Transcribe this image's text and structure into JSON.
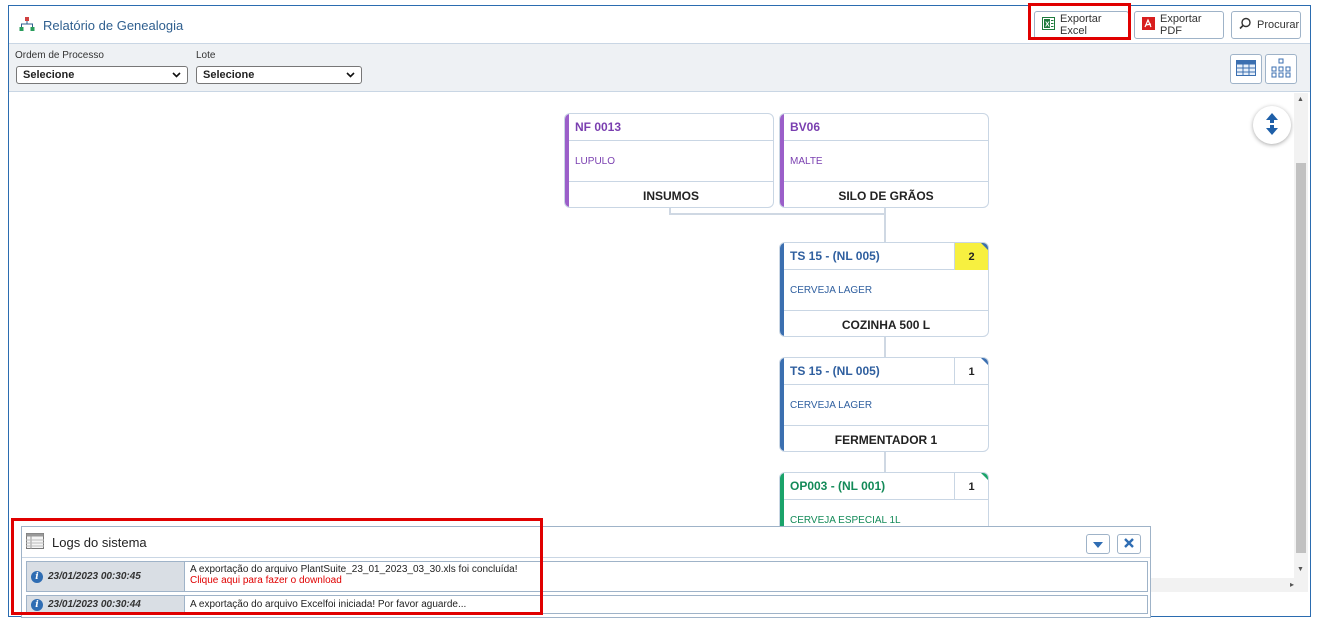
{
  "header": {
    "title": "Relatório de Genealogia",
    "export_excel_label": "Exportar Excel",
    "export_pdf_label": "Exportar PDF",
    "search_label": "Procurar"
  },
  "filters": {
    "process_order_label": "Ordem de Processo",
    "process_order_value": "Selecione",
    "lot_label": "Lote",
    "lot_value": "Selecione"
  },
  "nodes": [
    {
      "code": "NF 0013",
      "product": "LUPULO",
      "location": "INSUMOS",
      "color": "#9b5fc9"
    },
    {
      "code": "BV06",
      "product": "MALTE",
      "location": "SILO DE GRÃOS",
      "color": "#9b5fc9"
    },
    {
      "code": "TS 15 - (NL 005)",
      "product": "CERVEJA LAGER",
      "location": "COZINHA 500 L",
      "badge": "2",
      "color": "#3b6fb0",
      "badge_color": "#f7f040"
    },
    {
      "code": "TS 15 - (NL 005)",
      "product": "CERVEJA LAGER",
      "location": "FERMENTADOR 1",
      "badge": "1",
      "color": "#3b6fb0"
    },
    {
      "code": "OP003 - (NL 001)",
      "product": "CERVEJA ESPECIAL 1L",
      "location": "",
      "badge": "1",
      "color": "#1aa36a"
    }
  ],
  "logs": {
    "title": "Logs do sistema",
    "entries": [
      {
        "time": "23/01/2023 00:30:45",
        "message": "A exportação do arquivo PlantSuite_23_01_2023_03_30.xls foi concluída!",
        "link": "Clique aqui para fazer o download"
      },
      {
        "time": "23/01/2023 00:30:44",
        "message": "A exportação do arquivo Excelfoi iniciada! Por favor aguarde..."
      }
    ]
  },
  "colors": {
    "highlight": "#e00000",
    "accent_blue": "#2f5f8f",
    "lot_purple": "#9b5fc9",
    "process_blue": "#3b6fb0",
    "order_green": "#1aa36a"
  }
}
